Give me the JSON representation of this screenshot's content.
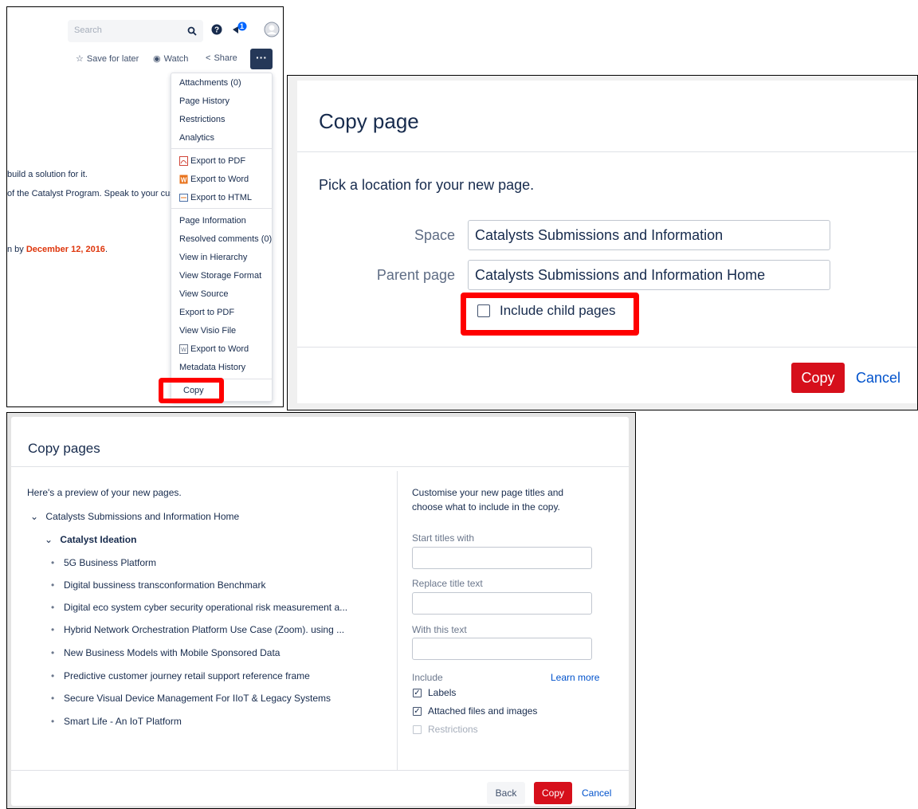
{
  "panel1": {
    "search_placeholder": "Search",
    "notification_count": "1",
    "actions": {
      "save_for_later": "Save for later",
      "watch": "Watch",
      "share": "Share",
      "more": "···"
    },
    "menu": {
      "group1": [
        "Attachments (0)",
        "Page History",
        "Restrictions",
        "Analytics"
      ],
      "group2": [
        "Export to PDF",
        "Export to Word",
        "Export to HTML"
      ],
      "group3": [
        "Page Information",
        "Resolved comments (0)",
        "View in Hierarchy",
        "View Storage Format",
        "View Source",
        "Export to PDF",
        "View Visio File",
        "Export to Word",
        "Metadata History"
      ],
      "copy": "Copy"
    },
    "body": {
      "line1": "build a solution for it.",
      "line2": "of the Catalyst Program. Speak to your cus",
      "line3_prefix": "n by ",
      "line3_date": "December 12, 2016",
      "line3_suffix": "."
    }
  },
  "panel2": {
    "title": "Copy page",
    "subtitle": "Pick a location for your new page.",
    "space_label": "Space",
    "space_value": "Catalysts Submissions and Information",
    "parent_label": "Parent page",
    "parent_value": "Catalysts Submissions and Information Home",
    "include_child_pages": "Include child pages",
    "copy_button": "Copy",
    "cancel_button": "Cancel"
  },
  "panel3": {
    "title": "Copy pages",
    "preview_heading": "Here's a preview of your new pages.",
    "tree_root": "Catalysts Submissions and Information Home",
    "tree_child": "Catalyst Ideation",
    "tree_items": [
      "5G Business Platform",
      "Digital bussiness transconformation Benchmark",
      "Digital eco system cyber security operational risk measurement a...",
      "Hybrid Network Orchestration Platform Use Case (Zoom). using ...",
      "New Business Models with Mobile Sponsored Data",
      "Predictive customer journey retail support reference frame",
      "Secure Visual Device Management For IIoT & Legacy Systems",
      "Smart Life - An IoT Platform"
    ],
    "customise_line1": "Customise your new page titles and",
    "customise_line2": "choose what to include in the copy.",
    "start_titles_label": "Start titles with",
    "replace_title_label": "Replace title text",
    "with_text_label": "With this text",
    "include_label": "Include",
    "learn_more": "Learn more",
    "options": [
      {
        "label": "Labels",
        "checked": true,
        "enabled": true
      },
      {
        "label": "Attached files and images",
        "checked": true,
        "enabled": true
      },
      {
        "label": "Restrictions",
        "checked": false,
        "enabled": false
      }
    ],
    "back_button": "Back",
    "copy_button": "Copy",
    "cancel_button": "Cancel"
  },
  "colors": {
    "copy_red": "#d60f1b",
    "highlight_red": "#ff0000",
    "link_blue": "#0052cc",
    "nav_dark": "#253858"
  }
}
